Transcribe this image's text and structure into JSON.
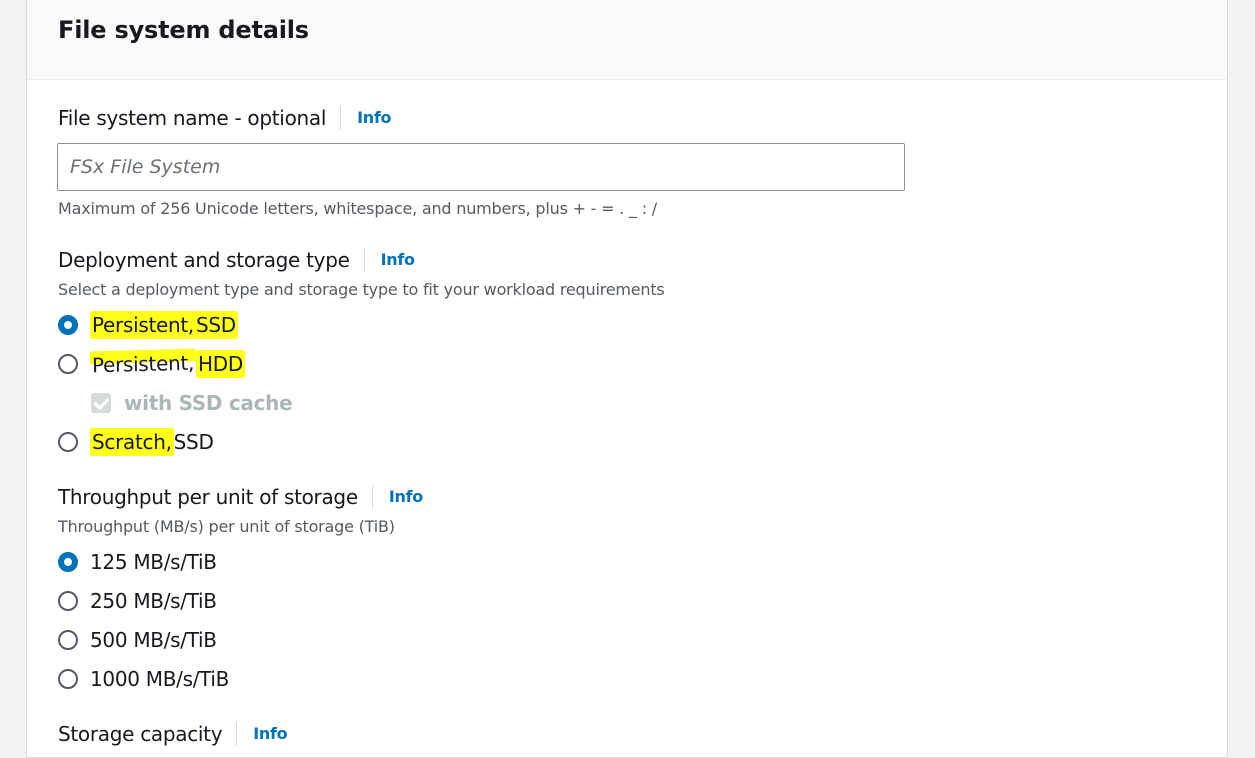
{
  "header": {
    "title": "File system details"
  },
  "name_field": {
    "label": "File system name - optional",
    "info": "Info",
    "placeholder": "FSx File System",
    "hint": "Maximum of 256 Unicode letters, whitespace, and numbers, plus + - = . _ : /"
  },
  "deployment": {
    "label": "Deployment and storage type",
    "info": "Info",
    "description": "Select a deployment type and storage type to fit your workload requirements",
    "options": [
      {
        "part1": "Persistent,",
        "part2": " SSD",
        "checked": true
      },
      {
        "part1": "Persistent,",
        "part2": " HDD",
        "checked": false
      },
      {
        "part1": "Scratch, ",
        "part2": "SSD",
        "checked": false
      }
    ],
    "cache_option": {
      "label": "with SSD cache",
      "checked": true,
      "disabled": true
    }
  },
  "throughput": {
    "label": "Throughput per unit of storage",
    "info": "Info",
    "description": "Throughput (MB/s) per unit of storage (TiB)",
    "options": [
      {
        "label": "125 MB/s/TiB",
        "checked": true
      },
      {
        "label": "250 MB/s/TiB",
        "checked": false
      },
      {
        "label": "500 MB/s/TiB",
        "checked": false
      },
      {
        "label": "1000 MB/s/TiB",
        "checked": false
      }
    ]
  },
  "storage_capacity": {
    "label": "Storage capacity",
    "info": "Info"
  },
  "colors": {
    "accent": "#0073bb",
    "highlight": "#ffff1a"
  }
}
